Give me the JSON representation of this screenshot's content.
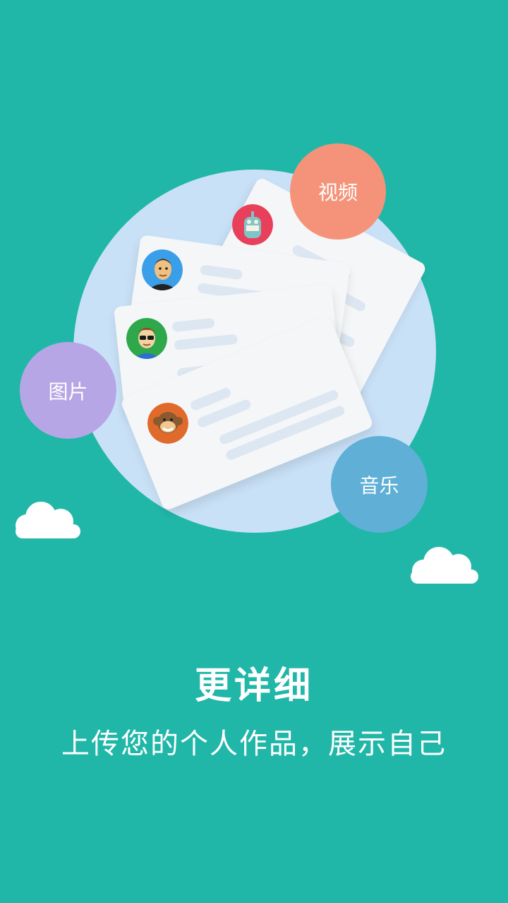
{
  "bubbles": {
    "video": "视频",
    "image": "图片",
    "music": "音乐"
  },
  "headline": "更详细",
  "tagline": "上传您的个人作品，展示自己",
  "colors": {
    "background": "#21b7a8",
    "circle": "#c9e1f7",
    "video_bubble": "#f5937a",
    "image_bubble": "#b6a6e6",
    "music_bubble": "#5fafd6"
  }
}
